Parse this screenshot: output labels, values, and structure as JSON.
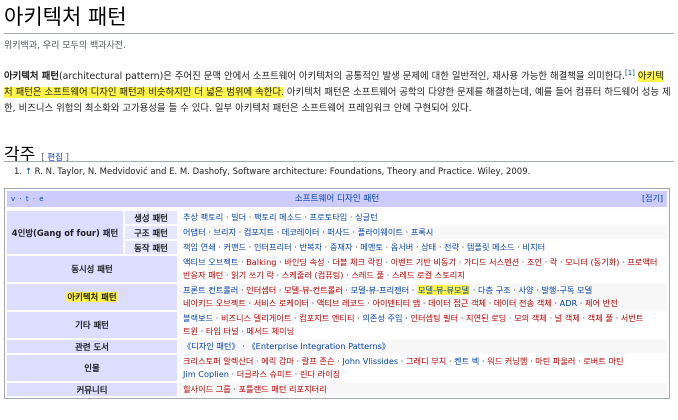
{
  "title": "아키텍처 패턴",
  "tagline": "위키백과, 우리 모두의 백과사전.",
  "intro": {
    "term": "아키텍처 패턴",
    "part1": "(architectural pattern)은 주어진 문맥 안에서 소프트웨어 아키텍처의 공통적인 발생 문제에 대한 일반적인, 재사용 가능한 해결책을 의미한다.",
    "ref_mark": "[1]",
    "highlight": "아키텍처 패턴은 소프트웨어 디자인 패턴과 비슷하지만 더 넓은 범위에 속한다.",
    "part2": " 아키텍처 패턴은 소프트웨어 공학의 다양한 문제를 해결하는데, 예를 들어 컴퓨터 하드웨어 성능 제한, 비즈니스 위험의 최소화와 고가용성을 들 수 있다. 일부 아키텍처 패턴은 소프트웨어 프레임워크 안에 구현되어 있다."
  },
  "notes": {
    "heading": "각주",
    "edit_open": "[ ",
    "edit_label": "편집",
    "edit_close": " ]",
    "ref_number": "1.",
    "ref_arrow": "↑",
    "ref_text": "R. N. Taylor, N. Medvidović and E. M. Dashofy, Software architecture: Foundations, Theory and Practice. Wiley, 2009."
  },
  "navbox": {
    "vte": "v · t · e",
    "title": "소프트웨어 디자인 패턴",
    "collapse": "[접기]",
    "gof_label": "4인방(Gang of four) 패턴",
    "rows": [
      {
        "sub": "생성 패턴",
        "items": [
          "추상 팩토리",
          "빌더",
          "팩토리 메소드",
          "프로토타입",
          "싱글턴"
        ]
      },
      {
        "sub": "구조 패턴",
        "items": [
          "어댑터",
          "브리지",
          "컴포지트",
          "데코레이터",
          "퍼사드",
          "플라이웨이트",
          "프록시"
        ]
      },
      {
        "sub": "동작 패턴",
        "items": [
          "책임 연쇄",
          "커맨드",
          "인터프리터",
          "반복자",
          "중재자",
          "메멘토",
          "옵서버",
          "상태",
          "전략",
          "템플릿 메소드",
          "비지터"
        ]
      }
    ],
    "concurrency": {
      "label": "동시성 패턴",
      "lines": [
        [
          "액티브 오브젝트",
          "Balking",
          "바인딩 속성",
          "더블 체크 락킹",
          "이벤트 기반 비동기",
          "가디드 서스펜션",
          "조인",
          "락",
          "모니터 (동기화)",
          "프로액터"
        ],
        [
          "반응자 패턴",
          "읽기 쓰기 락",
          "스케줄러 (컴퓨팅)",
          "스레드 풀",
          "스레드 로컬 스토리지"
        ]
      ]
    },
    "architecture": {
      "label": "아키텍처 패턴",
      "lines": [
        [
          "프론트 컨트롤러",
          "인터셉터",
          "모델-뷰-컨트롤러",
          "모델-뷰-프리젠터",
          "모델-뷰-뷰모델",
          "다층 구조",
          "사양",
          "발행-구독 모델"
        ],
        [
          "네이키드 오브젝트",
          "서비스 로케이터",
          "액티브 레코드",
          "아이덴티티 맵",
          "데이터 접근 객체",
          "데이터 전송 객체",
          "ADR",
          "제어 반전"
        ]
      ],
      "highlight_item": "모델-뷰-뷰모델"
    },
    "other": {
      "label": "기타 패턴",
      "lines": [
        [
          "블랙보드",
          "비즈니스 델리게이트",
          "컴포지트 엔티티",
          "의존성 주입",
          "인터셉팅 필터",
          "지연된 로딩",
          "모의 객체",
          "널 객체",
          "객체 풀",
          "서번트"
        ],
        [
          "트윈",
          "타입 터널",
          "메서드 체이닝"
        ]
      ]
    },
    "related": {
      "label": "관련 도서",
      "items": [
        "《디자인 패턴》",
        "《Enterprise Integration Patterns》"
      ]
    },
    "people": {
      "label": "인물",
      "lines": [
        [
          "크리스토퍼 알렉산더",
          "에릭 감마",
          "랄프 존슨",
          "John Vlissides",
          "그래디 부치",
          "켄트 벡",
          "워드 커닝햄",
          "마틴 파울러",
          "로버트 마틴"
        ],
        [
          "Jim Coplien",
          "더글라스 슈미트",
          "린다 라이징"
        ]
      ]
    },
    "community": {
      "label": "커뮤니티",
      "items": [
        "힐사이드 그룹",
        "포틀랜드 패턴 리포지터리"
      ]
    }
  }
}
